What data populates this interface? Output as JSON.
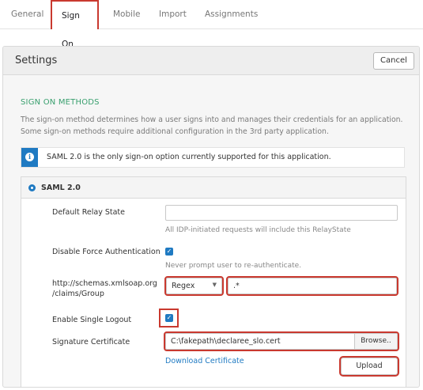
{
  "tabs": [
    {
      "label": "General"
    },
    {
      "label": "Sign On"
    },
    {
      "label": "Mobile"
    },
    {
      "label": "Import"
    },
    {
      "label": "Assignments"
    }
  ],
  "settings": {
    "title": "Settings",
    "cancel_label": "Cancel",
    "section_title": "SIGN ON METHODS",
    "section_desc": "The sign-on method determines how a user signs into and manages their credentials for an application. Some sign-on methods require additional configuration in the 3rd party application.",
    "info_text": "SAML 2.0 is the only sign-on option currently supported for this application."
  },
  "saml": {
    "label": "SAML 2.0",
    "relay_state": {
      "label": "Default Relay State",
      "value": "",
      "hint": "All IDP-initiated requests will include this RelayState"
    },
    "force_auth": {
      "label": "Disable Force Authentication",
      "checked": true,
      "hint": "Never prompt user to re-authenticate."
    },
    "group": {
      "label_line1": "http://schemas.xmlsoap.org",
      "label_line2": "/claims/Group",
      "filter_type": "Regex",
      "filter_value": ".*"
    },
    "single_logout": {
      "label": "Enable Single Logout",
      "checked": true
    },
    "signature": {
      "label": "Signature Certificate",
      "path": "C:\\fakepath\\declaree_slo.cert",
      "browse_label": "Browse..",
      "download_label": "Download Certificate",
      "upload_label": "Upload"
    }
  },
  "colors": {
    "accent": "#1f7ac2",
    "section": "#3aa06f",
    "highlight": "#c9392f"
  }
}
